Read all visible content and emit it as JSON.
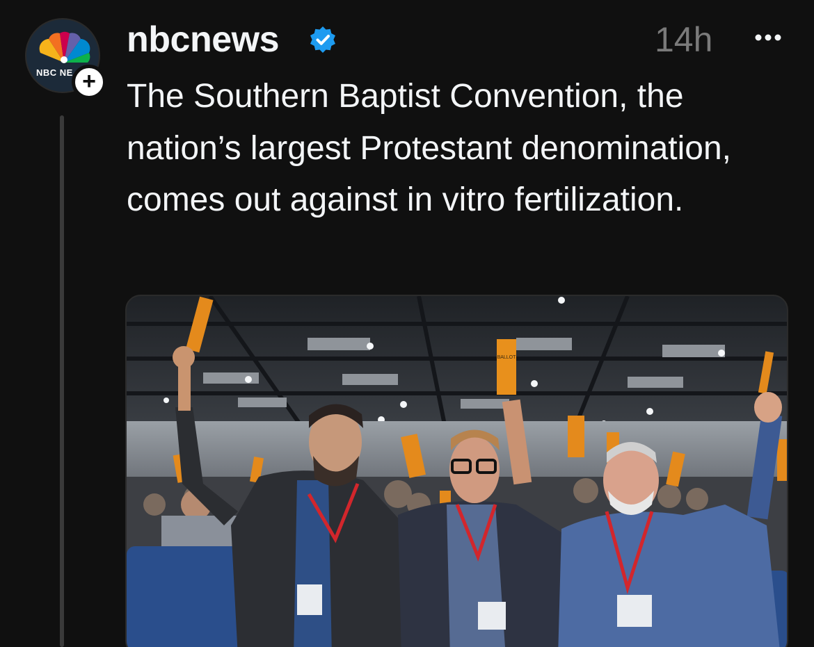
{
  "post": {
    "author": {
      "username": "nbcnews",
      "avatar_label": "NBC NE",
      "verified": true,
      "verified_color": "#1d9bf0"
    },
    "timestamp": "14h",
    "text": "The Southern Baptist Convention, the nation’s largest Protestant denomination, comes out against in vitro fertilization.",
    "media": {
      "ballot_label": "BALLOT"
    },
    "icons": {
      "follow": "plus-icon",
      "more": "more-dots-icon",
      "verified": "verified-badge-icon"
    }
  }
}
